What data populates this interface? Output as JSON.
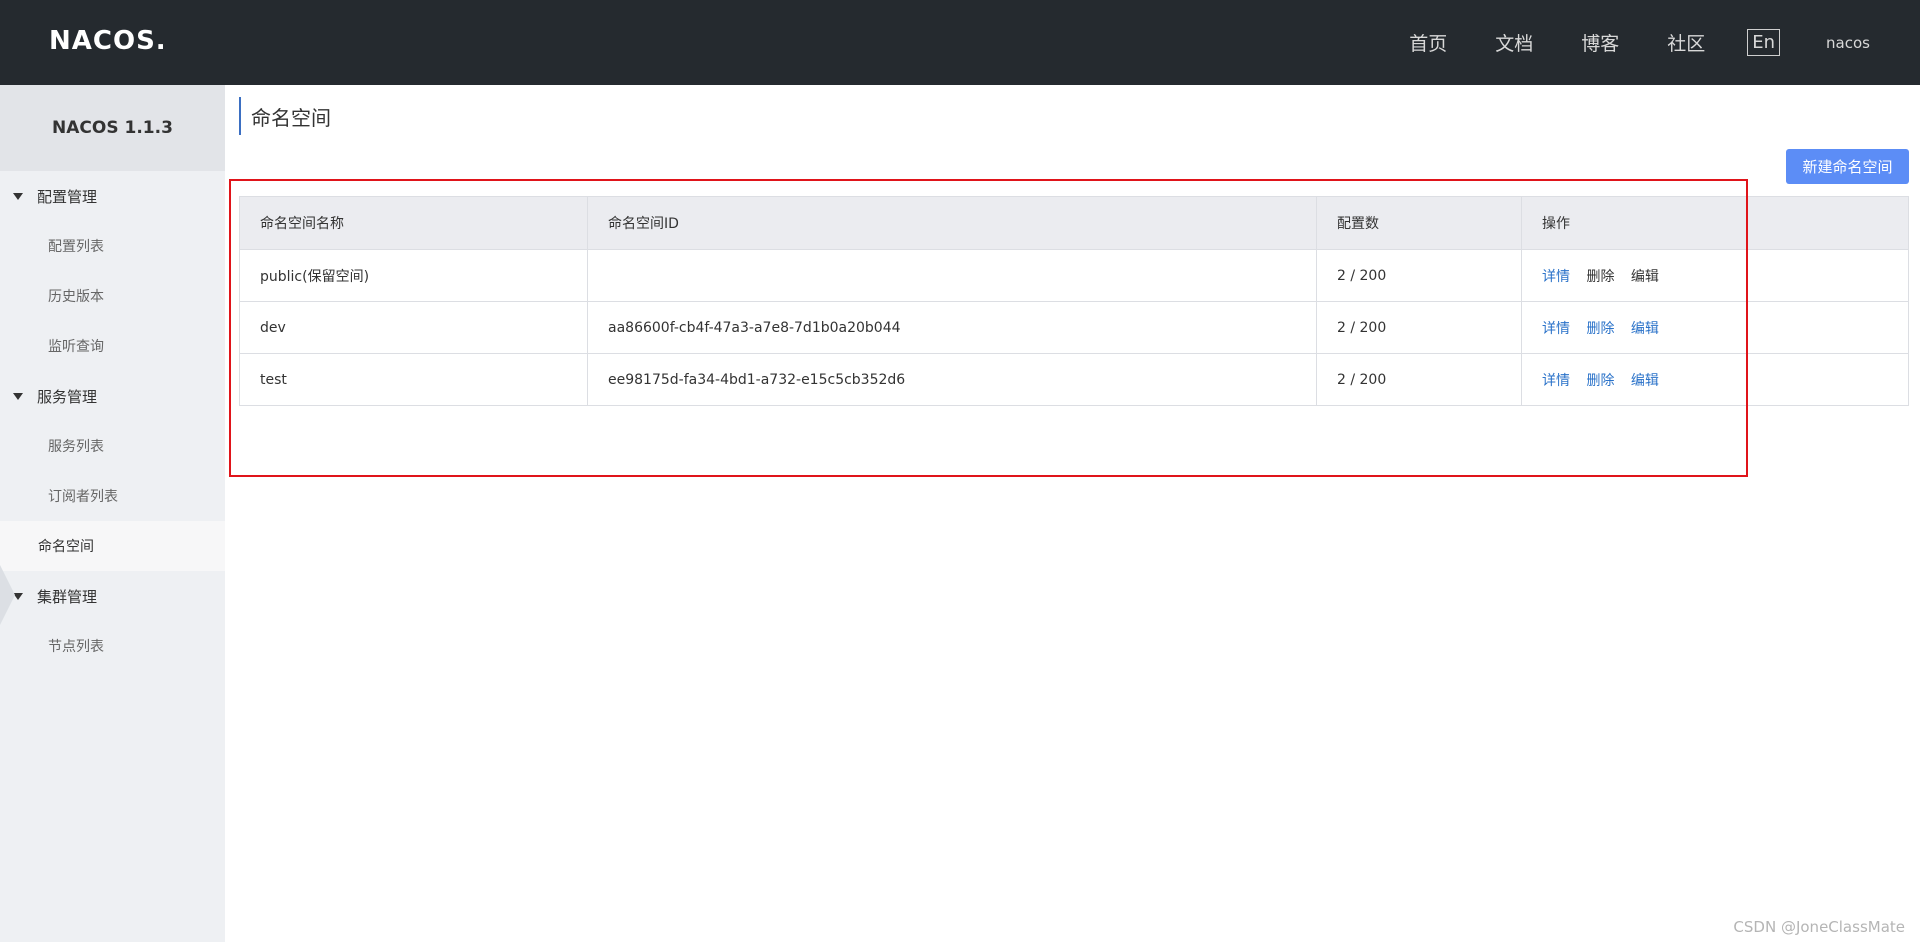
{
  "header": {
    "logo_text": "NACOS",
    "logo_dot": ".",
    "nav": [
      "首页",
      "文档",
      "博客",
      "社区"
    ],
    "lang": "En",
    "user": "nacos"
  },
  "sidebar": {
    "title": "NACOS 1.1.3",
    "groups": [
      {
        "label": "配置管理",
        "items": [
          "配置列表",
          "历史版本",
          "监听查询"
        ]
      },
      {
        "label": "服务管理",
        "items": [
          "服务列表",
          "订阅者列表"
        ]
      },
      {
        "label": "集群管理",
        "items": [
          "节点列表"
        ]
      }
    ],
    "active_item": "命名空间"
  },
  "main": {
    "title": "命名空间",
    "new_button": "新建命名空间",
    "table": {
      "headers": [
        "命名空间名称",
        "命名空间ID",
        "配置数",
        "操作"
      ],
      "rows": [
        {
          "name": "public(保留空间)",
          "id": "",
          "count": "2 / 200",
          "ops": [
            "详情",
            "删除",
            "编辑"
          ]
        },
        {
          "name": "dev",
          "id": "aa86600f-cb4f-47a3-a7e8-7d1b0a20b044",
          "count": "2 / 200",
          "ops": [
            "详情",
            "删除",
            "编辑"
          ]
        },
        {
          "name": "test",
          "id": "ee98175d-fa34-4bd1-a732-e15c5cb352d6",
          "count": "2 / 200",
          "ops": [
            "详情",
            "删除",
            "编辑"
          ]
        }
      ]
    }
  },
  "watermark": "CSDN @JoneClassMate",
  "colors": {
    "header_bg": "#252a2f",
    "sidebar_bg": "#eef0f3",
    "primary_button": "#5c8df6",
    "link": "#2a72c9",
    "highlight_border": "#e0141a"
  }
}
